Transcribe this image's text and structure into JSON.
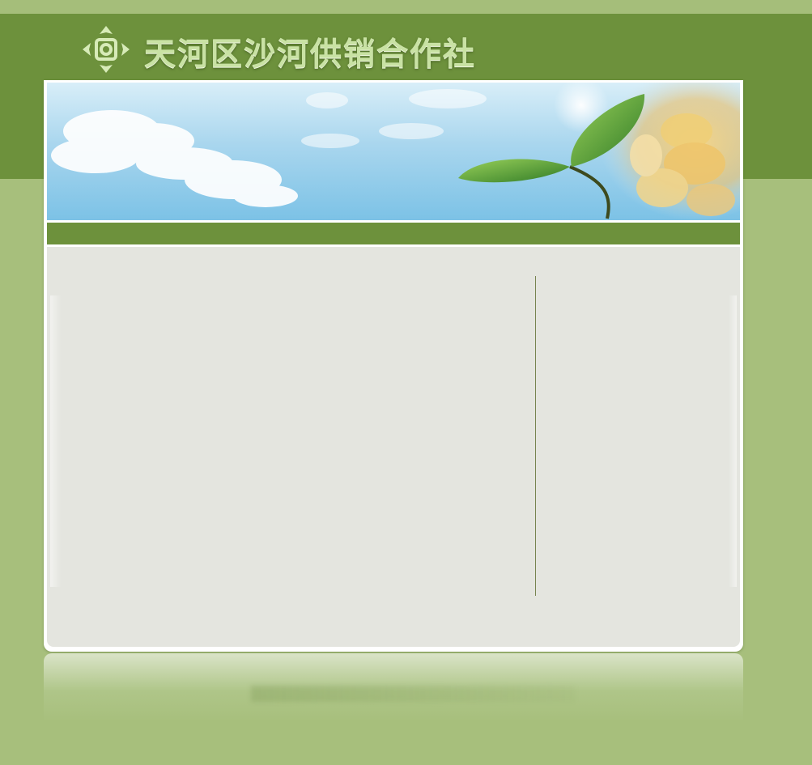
{
  "site": {
    "title": "天河区沙河供销合作社",
    "logo_icon": "coop-emblem-icon"
  },
  "colors": {
    "page_background": "#a7bf7c",
    "header_band": "#6d913c",
    "nav_bar": "#6d913c",
    "content_panel": "#e4e5df",
    "title_text": "#c9e2a4",
    "divider": "#77844f"
  },
  "banner": {
    "image": "sky-clouds-seedling-beans-illustration"
  }
}
